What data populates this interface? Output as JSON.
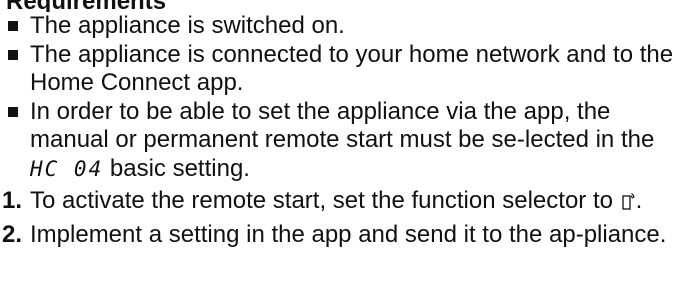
{
  "heading": "Requirements",
  "requirements": [
    {
      "text": "The appliance is switched on."
    },
    {
      "text": "The appliance is connected to your home network and to the Home Connect app."
    },
    {
      "text_before": "In order to be able to set the appliance via the app, the manual or permanent remote start must be se-lected in the ",
      "display_code": "HC 04",
      "text_after": " basic setting."
    }
  ],
  "steps": [
    {
      "number": "1.",
      "text_before": "To activate the remote start, set the function selector to ",
      "icon": "remote-start-icon",
      "text_after": "."
    },
    {
      "number": "2.",
      "text": "Implement a setting in the app and send it to the ap-pliance."
    }
  ]
}
